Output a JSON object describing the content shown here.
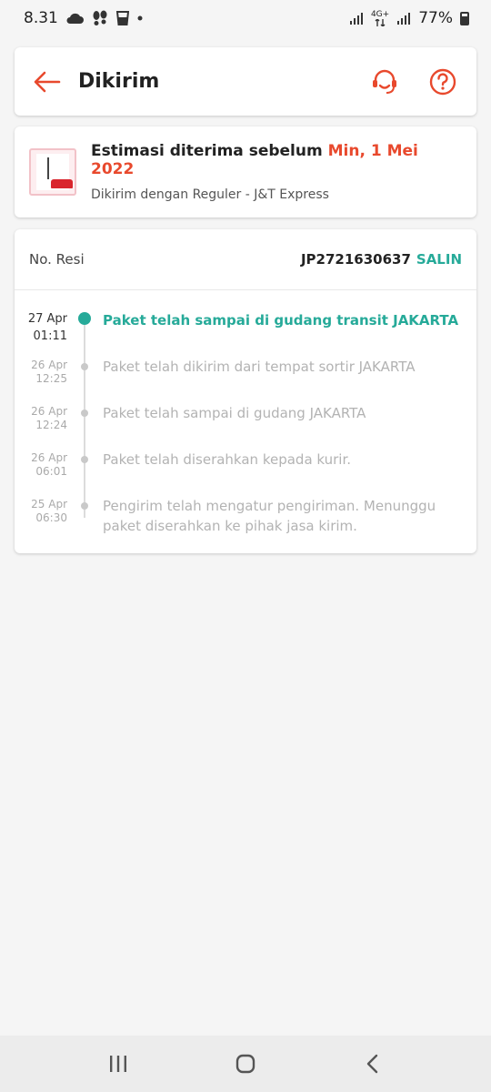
{
  "status_bar": {
    "time": "8.31",
    "network": "4G+",
    "battery": "77%"
  },
  "header": {
    "title": "Dikirim",
    "icons": [
      "back-arrow-icon",
      "customer-service-icon",
      "help-icon"
    ],
    "accent_color": "#e8492d"
  },
  "estimate": {
    "prefix": "Estimasi diterima sebelum",
    "date": "Min, 1 Mei 2022",
    "shipping": "Dikirim dengan Reguler - J&T Express"
  },
  "tracking": {
    "resi_label": "No. Resi",
    "resi_number": "JP2721630637",
    "copy_label": "SALIN",
    "events": [
      {
        "date": "27 Apr",
        "time": "01:11",
        "desc": "Paket telah sampai di gudang transit JAKARTA"
      },
      {
        "date": "26 Apr",
        "time": "12:25",
        "desc": "Paket telah dikirim dari tempat sortir JAKARTA"
      },
      {
        "date": "26 Apr",
        "time": "12:24",
        "desc": "Paket telah sampai di gudang JAKARTA"
      },
      {
        "date": "26 Apr",
        "time": "06:01",
        "desc": "Paket telah diserahkan kepada kurir."
      },
      {
        "date": "25 Apr",
        "time": "06:30",
        "desc": "Pengirim telah mengatur pengiriman. Menunggu paket diserahkan ke pihak jasa kirim."
      }
    ],
    "active_color": "#26aa99"
  },
  "nav_bar": {
    "icons": [
      "recent-apps-icon",
      "home-icon",
      "back-icon"
    ]
  }
}
